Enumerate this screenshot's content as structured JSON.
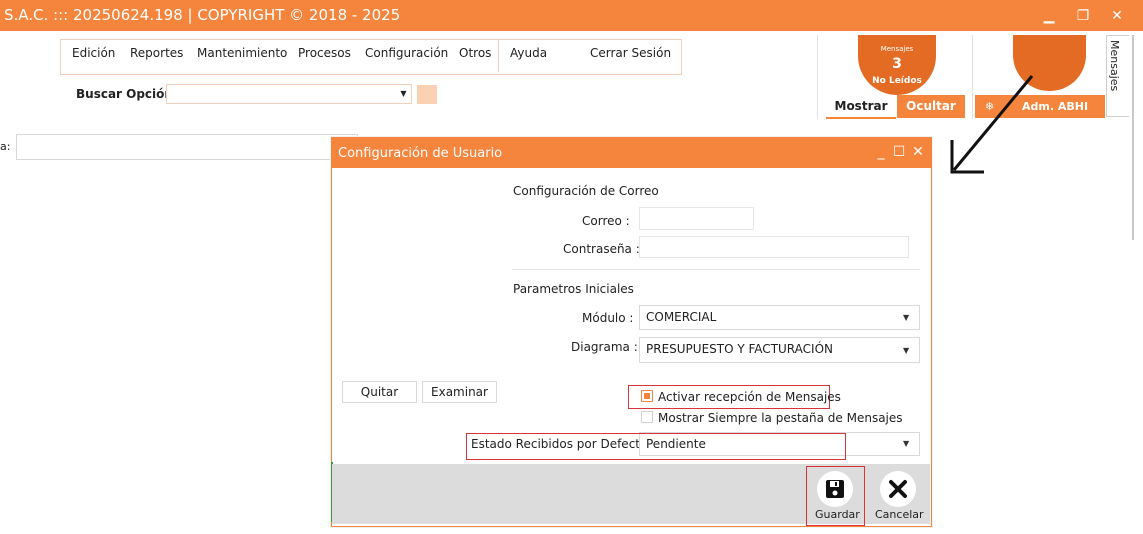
{
  "window": {
    "title": "S.A.C. ::: 20250624.198 | COPYRIGHT ©  2018 - 2025",
    "minimize_icon": "minimize-icon",
    "restore_icon": "restore-icon",
    "close_icon": "close-icon"
  },
  "menu": {
    "items": [
      "Edición",
      "Reportes",
      "Mantenimiento",
      "Procesos",
      "Configuración",
      "Otros",
      "Ayuda",
      "Cerrar Sesión"
    ]
  },
  "search": {
    "label": "Buscar Opción :",
    "value": ""
  },
  "messages": {
    "small_label": "Mensajes",
    "count": "3",
    "status": "No Leídos",
    "show_label": "Mostrar",
    "hide_label": "Ocultar",
    "side_tab_label": "Mensajes"
  },
  "user": {
    "name": "Adm. ABHI",
    "icon": "gear-icon"
  },
  "background_form": {
    "label": "a:"
  },
  "dialog": {
    "title": "Configuración de Usuario",
    "email_section": {
      "heading": "Configuración de Correo",
      "email_label": "Correo :",
      "email_value": "",
      "password_label": "Contraseña :",
      "password_value": ""
    },
    "params_section": {
      "heading": "Parametros Iniciales",
      "module_label": "Módulo :",
      "module_value": "COMERCIAL",
      "diagram_label": "Diagrama :",
      "diagram_value": "PRESUPUESTO Y FACTURACIÓN"
    },
    "image_buttons": {
      "remove_label": "Quitar",
      "browse_label": "Examinar"
    },
    "checkbox_receive": {
      "label": "Activar recepción de Mensajes",
      "checked": true
    },
    "checkbox_always_show": {
      "label": "Mostrar Siempre la pestaña de Mensajes",
      "checked": false
    },
    "default_status": {
      "label": "Estado Recibidos por Defecto :",
      "value": "Pendiente"
    },
    "footer": {
      "save_label": "Guardar",
      "cancel_label": "Cancelar"
    }
  },
  "colors": {
    "accent": "#f5843c",
    "accent_dark": "#e46b23",
    "highlight_frame": "#d9333a"
  }
}
